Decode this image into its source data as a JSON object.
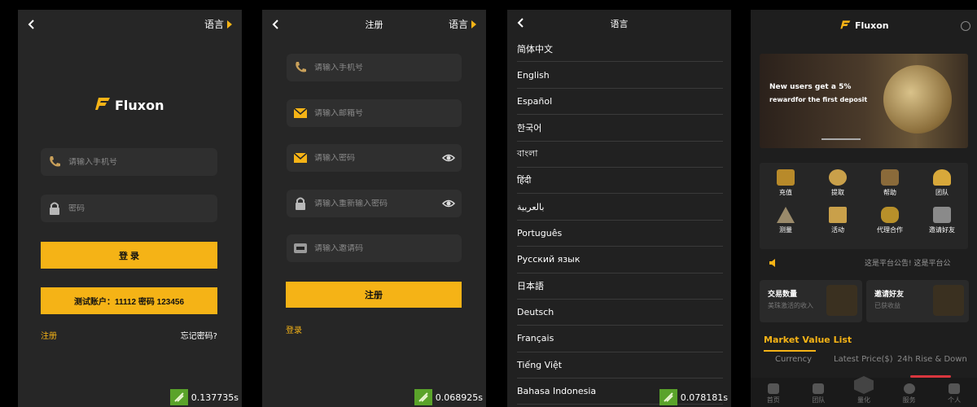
{
  "login": {
    "lang_label": "语言",
    "logo_text": "Fluxon",
    "phone_placeholder": "请输入手机号",
    "password_placeholder": "密码",
    "login_button": "登 录",
    "test_account_button": "测试账户：11112 密码 123456",
    "register_link": "注册",
    "forgot_link": "忘记密码?",
    "timer": "0.137735s"
  },
  "register": {
    "title": "注册",
    "lang_label": "语言",
    "phone_placeholder": "请输入手机号",
    "email_placeholder": "请输入邮箱号",
    "password_placeholder": "请输入密码",
    "repeat_placeholder": "请输入重新输入密码",
    "invite_placeholder": "请输入邀请码",
    "register_button": "注册",
    "login_link": "登录",
    "timer": "0.068925s"
  },
  "language": {
    "title": "语言",
    "items": [
      "简体中文",
      "English",
      "Español",
      "한국어",
      "বাংলা",
      "हिंदी",
      "بالعربية",
      "Português",
      "Русский язык",
      "日本語",
      "Deutsch",
      "Français",
      "Tiếng Việt",
      "Bahasa Indonesia"
    ],
    "timer": "0.078181s"
  },
  "home": {
    "logo_text": "Fluxon",
    "banner_line1": "New users get a 5%",
    "banner_line2": "rewardfor the first deposit",
    "grid": [
      "充值",
      "提取",
      "帮助",
      "团队",
      "测量",
      "活动",
      "代理合作",
      "邀请好友"
    ],
    "notice": "这是平台公告! 这是平台公",
    "card1_title": "交易数量",
    "card1_sub": "美珠激活的收入",
    "card2_title": "邀请好友",
    "card2_sub": "已获收益",
    "market_title": "Market Value List",
    "col_currency": "Currency",
    "col_price": "Latest Price($)",
    "col_change": "24h Rise & Down",
    "nav": [
      "首页",
      "团队",
      "量化",
      "服务",
      "个人"
    ],
    "colors": {
      "accent": "#f5b316",
      "panel": "#262626",
      "bg": "#000000"
    }
  }
}
